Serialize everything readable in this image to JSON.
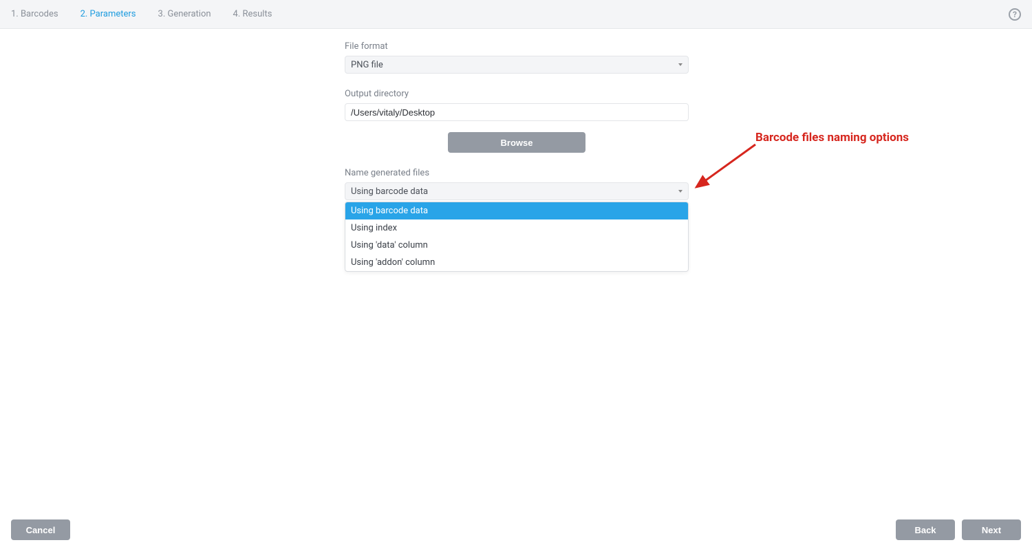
{
  "steps": [
    "1. Barcodes",
    "2. Parameters",
    "3. Generation",
    "4. Results"
  ],
  "activeStepIndex": 1,
  "labels": {
    "fileFormat": "File format",
    "outputDirectory": "Output directory",
    "browse": "Browse",
    "nameGenerated": "Name generated files"
  },
  "fileFormatValue": "PNG file",
  "outputDirValue": "/Users/vitaly/Desktop",
  "nameGeneratedValue": "Using barcode data",
  "nameOptions": [
    "Using barcode data",
    "Using index",
    "Using 'data' column",
    "Using 'addon' column"
  ],
  "annotation": "Barcode files naming options",
  "footer": {
    "cancel": "Cancel",
    "back": "Back",
    "next": "Next"
  },
  "helpGlyph": "?"
}
